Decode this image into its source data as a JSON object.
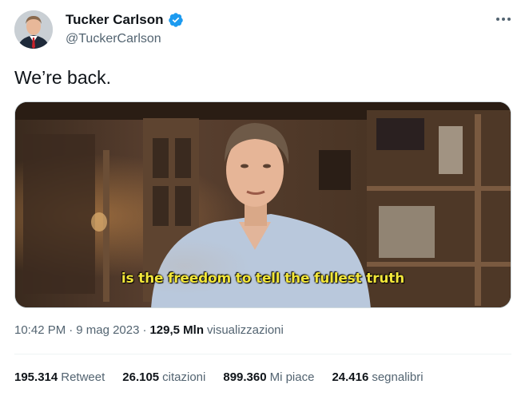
{
  "author": {
    "display_name": "Tucker Carlson",
    "handle": "@TuckerCarlson",
    "verified": true
  },
  "tweet": {
    "text": "We’re back.",
    "video_subtitle": "is the freedom to tell the fullest truth"
  },
  "meta": {
    "time": "10:42 PM",
    "separator": "·",
    "date": "9 mag 2023",
    "views_count": "129,5 Mln",
    "views_label": "visualizzazioni"
  },
  "stats": [
    {
      "count": "195.314",
      "label": "Retweet"
    },
    {
      "count": "26.105",
      "label": "citazioni"
    },
    {
      "count": "899.360",
      "label": "Mi piace"
    },
    {
      "count": "24.416",
      "label": "segnalibri"
    }
  ],
  "colors": {
    "verified_blue": "#1d9bf0",
    "secondary_text": "#536471",
    "primary_text": "#0f1419",
    "subtitle_yellow": "#f2e63a"
  }
}
